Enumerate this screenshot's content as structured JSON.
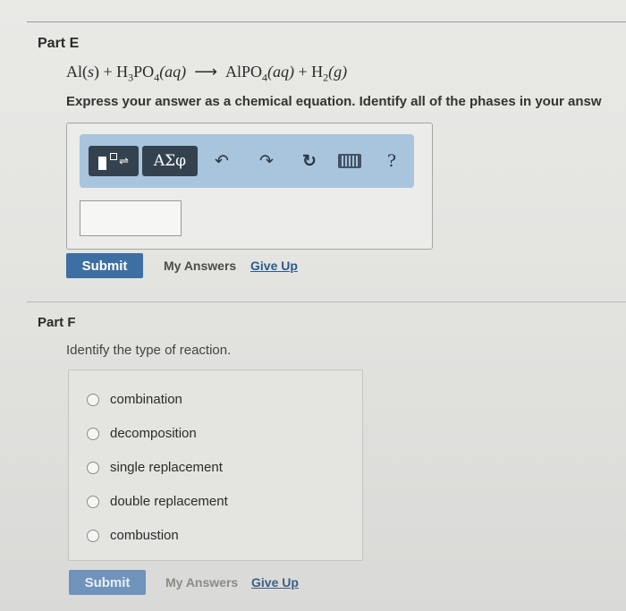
{
  "part_e": {
    "label": "Part E",
    "equation": {
      "r1": "Al(",
      "r1_phase": "s",
      "r1_close": ") + H",
      "r2_sub1": "3",
      "r2_mid": "PO",
      "r2_sub2": "4",
      "r2_phase": "(aq)",
      "arrow": "⟶",
      "p1": "AlPO",
      "p1_sub": "4",
      "p1_phase": "(aq)",
      "plus": " + H",
      "p2_sub": "2",
      "p2_phase": "(g)"
    },
    "instruction": "Express your answer as a chemical equation. Identify all of the phases in your answ",
    "toolbar": {
      "greek_label": "ΑΣφ",
      "undo_glyph": "↶",
      "redo_glyph": "↷",
      "reset_glyph": "↻",
      "help_label": "?"
    },
    "input_value": "",
    "submit_label": "Submit",
    "my_answers_label": "My Answers",
    "give_up_label": "Give Up"
  },
  "part_f": {
    "label": "Part F",
    "question": "Identify the type of reaction.",
    "options": [
      "combination",
      "decomposition",
      "single replacement",
      "double replacement",
      "combustion"
    ],
    "submit_label": "Submit",
    "my_answers_label": "My Answers",
    "give_up_label": "Give Up"
  }
}
